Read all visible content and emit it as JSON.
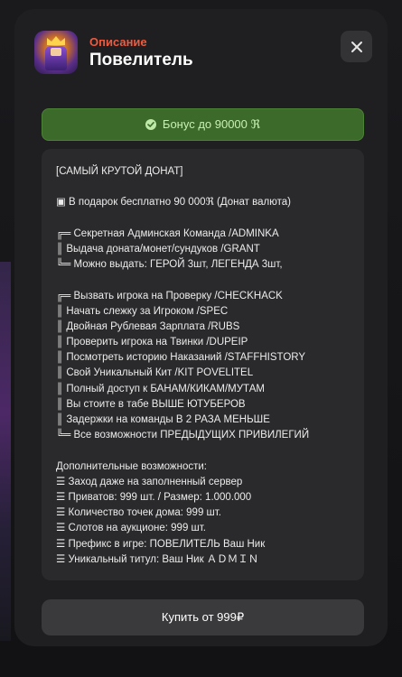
{
  "header": {
    "subtitle": "Описание",
    "title": "Повелитель"
  },
  "bonus": {
    "text": "Бонус до 90000 ℜ",
    "color": "#3b6a2a"
  },
  "description": {
    "lines": [
      "[САМЫЙ КРУТОЙ ДОНАТ]",
      "",
      "▣ В подарок бесплатно 90 000ℜ (Донат валюта)",
      "",
      "╔═ Секретная Админская Команда /ADMINKA",
      "║ Выдача доната/монет/сундуков /GRANT",
      "╚═ Можно выдать: ГЕРОЙ 3шт, ЛЕГЕНДА 3шт,",
      "",
      "╔═ Вызвать игрока на Проверку /CHECKHACK",
      "║ Начать слежку за Игроком /SPEC",
      "║ Двойная Рублевая Зарплата /RUBS",
      "║ Проверить игрока на Твинки /DUPEIP",
      "║ Посмотреть историю Наказаний /STAFFHISTORY",
      "║ Свой Уникальный Кит /KIT POVELITEL",
      "║ Полный доступ к БАНАМ/КИКАМ/МУТАМ",
      "║ Вы стоите в табе ВЫШЕ ЮТУБЕРОВ",
      "║ Задержки на команды В 2 РАЗА МЕНЬШЕ",
      "╚═ Все возможности ПРЕДЫДУЩИХ ПРИВИЛЕГИЙ",
      "",
      "Дополнительные возможности:",
      "☰ Заход даже на заполненный сервер",
      "☰ Приватов: 999 шт. / Размер: 1.000.000",
      "☰ Количество точек дома: 999 шт.",
      "☰ Слотов на аукционе: 999 шт.",
      "☰ Префикс в игре: ПОВЕЛИТЕЛЬ Ваш Ник",
      "☰ Уникальный титул: Ваш Ник ＡＤＭＩＮ"
    ]
  },
  "buy_button": {
    "label": "Купить от 999₽"
  },
  "icons": {
    "close": "close-icon",
    "check": "check-circle-icon",
    "product": "product-avatar-icon"
  }
}
